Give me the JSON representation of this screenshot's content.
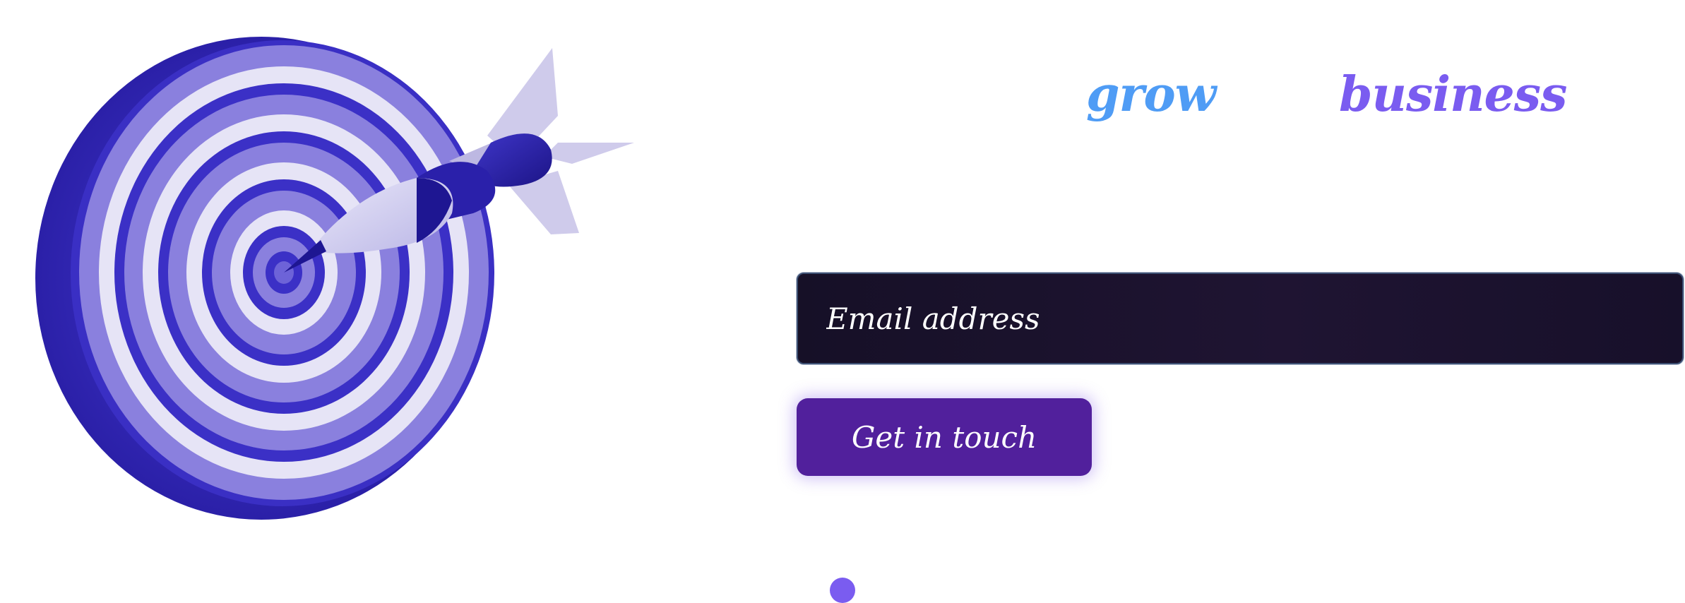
{
  "hero": {
    "headline_word_1": "grow",
    "headline_word_2": "business",
    "colors": {
      "headline_word_1": "#4f9cf5",
      "headline_word_2": "#7a5cf0",
      "button_background": "#51209c",
      "input_background": "#1a1230",
      "indicator_dot": "#7a5cf0"
    },
    "illustration": "dartboard-with-dart"
  },
  "signup": {
    "email_placeholder": "Email address",
    "email_value": "",
    "button_label": "Get in touch"
  },
  "carousel": {
    "indicator_icon": "dot-indicator"
  }
}
